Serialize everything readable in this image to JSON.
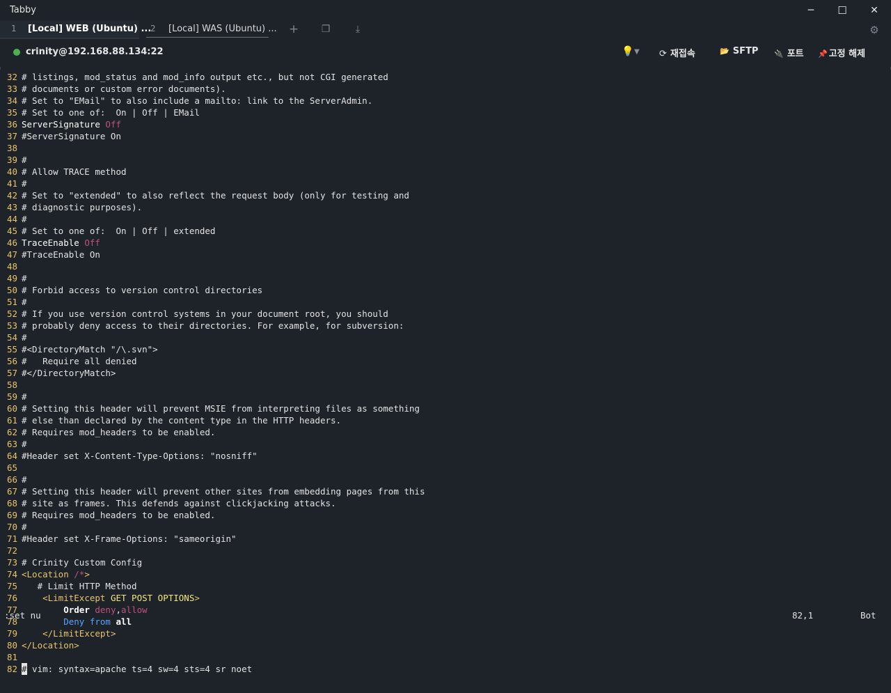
{
  "app": {
    "title": "Tabby"
  },
  "window_controls": {
    "minimize": "─",
    "maximize": "☐",
    "close": "✕"
  },
  "tabs": [
    {
      "num": "1",
      "label": "[Local] WEB (Ubuntu) ..."
    },
    {
      "num": "2",
      "label": "[Local] WAS (Ubuntu) ..."
    }
  ],
  "tab_tools": {
    "add": "+",
    "window": "❐",
    "download": "⤓",
    "settings": "⚙"
  },
  "connection": {
    "label": "crinity@192.168.88.134:22",
    "status_color": "#4caf50"
  },
  "toolbar": {
    "bulb_icon": "💡",
    "reconnect_icon": "⟳",
    "reconnect": "재접속",
    "sftp_icon": "📂",
    "sftp": "SFTP",
    "ports_icon": "🔌",
    "ports": "포트",
    "unpin_icon": "📌",
    "unpin": "고정 해제"
  },
  "terminal": {
    "lines": [
      {
        "n": "32",
        "segs": [
          [
            "c-comment",
            "# listings, mod_status and mod_info output etc., but not CGI generated"
          ]
        ]
      },
      {
        "n": "33",
        "segs": [
          [
            "c-comment",
            "# documents or custom error documents)."
          ]
        ]
      },
      {
        "n": "34",
        "segs": [
          [
            "c-comment",
            "# Set to \"EMail\" to also include a mailto: link to the ServerAdmin."
          ]
        ]
      },
      {
        "n": "35",
        "segs": [
          [
            "c-comment",
            "# Set to one of:  On | Off | EMail"
          ]
        ]
      },
      {
        "n": "36",
        "segs": [
          [
            "c-dir",
            "ServerSignature "
          ],
          [
            "c-val",
            "Off"
          ]
        ]
      },
      {
        "n": "37",
        "segs": [
          [
            "c-comment",
            "#ServerSignature On"
          ]
        ]
      },
      {
        "n": "38",
        "segs": []
      },
      {
        "n": "39",
        "segs": [
          [
            "c-comment",
            "#"
          ]
        ]
      },
      {
        "n": "40",
        "segs": [
          [
            "c-comment",
            "# Allow TRACE method"
          ]
        ]
      },
      {
        "n": "41",
        "segs": [
          [
            "c-comment",
            "#"
          ]
        ]
      },
      {
        "n": "42",
        "segs": [
          [
            "c-comment",
            "# Set to \"extended\" to also reflect the request body (only for testing and"
          ]
        ]
      },
      {
        "n": "43",
        "segs": [
          [
            "c-comment",
            "# diagnostic purposes)."
          ]
        ]
      },
      {
        "n": "44",
        "segs": [
          [
            "c-comment",
            "#"
          ]
        ]
      },
      {
        "n": "45",
        "segs": [
          [
            "c-comment",
            "# Set to one of:  On | Off | extended"
          ]
        ]
      },
      {
        "n": "46",
        "segs": [
          [
            "c-dir",
            "TraceEnable "
          ],
          [
            "c-val",
            "Off"
          ]
        ]
      },
      {
        "n": "47",
        "segs": [
          [
            "c-comment",
            "#TraceEnable On"
          ]
        ]
      },
      {
        "n": "48",
        "segs": []
      },
      {
        "n": "49",
        "segs": [
          [
            "c-comment",
            "#"
          ]
        ]
      },
      {
        "n": "50",
        "segs": [
          [
            "c-comment",
            "# Forbid access to version control directories"
          ]
        ]
      },
      {
        "n": "51",
        "segs": [
          [
            "c-comment",
            "#"
          ]
        ]
      },
      {
        "n": "52",
        "segs": [
          [
            "c-comment",
            "# If you use version control systems in your document root, you should"
          ]
        ]
      },
      {
        "n": "53",
        "segs": [
          [
            "c-comment",
            "# probably deny access to their directories. For example, for subversion:"
          ]
        ]
      },
      {
        "n": "54",
        "segs": [
          [
            "c-comment",
            "#"
          ]
        ]
      },
      {
        "n": "55",
        "segs": [
          [
            "c-comment",
            "#<DirectoryMatch \"/\\.svn\">"
          ]
        ]
      },
      {
        "n": "56",
        "segs": [
          [
            "c-comment",
            "#   Require all denied"
          ]
        ]
      },
      {
        "n": "57",
        "segs": [
          [
            "c-comment",
            "#</DirectoryMatch>"
          ]
        ]
      },
      {
        "n": "58",
        "segs": []
      },
      {
        "n": "59",
        "segs": [
          [
            "c-comment",
            "#"
          ]
        ]
      },
      {
        "n": "60",
        "segs": [
          [
            "c-comment",
            "# Setting this header will prevent MSIE from interpreting files as something"
          ]
        ]
      },
      {
        "n": "61",
        "segs": [
          [
            "c-comment",
            "# else than declared by the content type in the HTTP headers."
          ]
        ]
      },
      {
        "n": "62",
        "segs": [
          [
            "c-comment",
            "# Requires mod_headers to be enabled."
          ]
        ]
      },
      {
        "n": "63",
        "segs": [
          [
            "c-comment",
            "#"
          ]
        ]
      },
      {
        "n": "64",
        "segs": [
          [
            "c-comment",
            "#Header set X-Content-Type-Options: \"nosniff\""
          ]
        ]
      },
      {
        "n": "65",
        "segs": []
      },
      {
        "n": "66",
        "segs": [
          [
            "c-comment",
            "#"
          ]
        ]
      },
      {
        "n": "67",
        "segs": [
          [
            "c-comment",
            "# Setting this header will prevent other sites from embedding pages from this"
          ]
        ]
      },
      {
        "n": "68",
        "segs": [
          [
            "c-comment",
            "# site as frames. This defends against clickjacking attacks."
          ]
        ]
      },
      {
        "n": "69",
        "segs": [
          [
            "c-comment",
            "# Requires mod_headers to be enabled."
          ]
        ]
      },
      {
        "n": "70",
        "segs": [
          [
            "c-comment",
            "#"
          ]
        ]
      },
      {
        "n": "71",
        "segs": [
          [
            "c-comment",
            "#Header set X-Frame-Options: \"sameorigin\""
          ]
        ]
      },
      {
        "n": "72",
        "segs": []
      },
      {
        "n": "73",
        "segs": [
          [
            "c-comment",
            "# Crinity Custom Config"
          ]
        ]
      },
      {
        "n": "74",
        "segs": [
          [
            "c-tag",
            "<Location "
          ],
          [
            "c-val",
            "/*"
          ],
          [
            "c-tag",
            ">"
          ]
        ]
      },
      {
        "n": "75",
        "segs": [
          [
            "c-comment",
            "   # Limit HTTP Method"
          ]
        ]
      },
      {
        "n": "76",
        "segs": [
          [
            "c-plain",
            "    "
          ],
          [
            "c-tag",
            "<LimitExcept "
          ],
          [
            "c-kw2",
            "GET POST OPTIONS"
          ],
          [
            "c-tag",
            ">"
          ]
        ]
      },
      {
        "n": "77",
        "segs": [
          [
            "c-plain",
            "        "
          ],
          [
            "c-bright",
            "Order "
          ],
          [
            "c-val",
            "deny"
          ],
          [
            "c-plain",
            ","
          ],
          [
            "c-val",
            "allow"
          ]
        ]
      },
      {
        "n": "78",
        "segs": [
          [
            "c-plain",
            "        "
          ],
          [
            "c-kw",
            "Deny "
          ],
          [
            "c-kw",
            "from "
          ],
          [
            "c-bright",
            "all"
          ]
        ]
      },
      {
        "n": "79",
        "segs": [
          [
            "c-plain",
            "    "
          ],
          [
            "c-tag",
            "</LimitExcept>"
          ]
        ]
      },
      {
        "n": "80",
        "segs": [
          [
            "c-tag",
            "</Location>"
          ]
        ]
      },
      {
        "n": "81",
        "segs": []
      },
      {
        "n": "82",
        "segs": [
          [
            "cursor",
            "#"
          ],
          [
            "c-comment",
            " vim: syntax=apache ts=4 sw=4 sts=4 sr noet"
          ]
        ]
      }
    ],
    "command": ":set nu",
    "position": "82,1",
    "scroll": "Bot"
  }
}
